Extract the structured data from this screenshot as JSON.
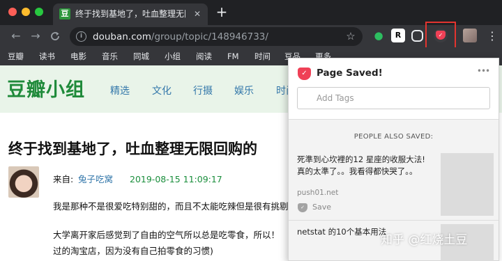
{
  "colors": {
    "tab_bar": "#202124",
    "toolbar": "#35363a",
    "douban_green": "#1f8a3a",
    "link_blue": "#3377aa",
    "pocket_red": "#ef4056",
    "highlight_red": "#e3342f"
  },
  "tab": {
    "favicon": "豆",
    "title": "终于找到基地了，吐血整理无限回购的",
    "close": "✕"
  },
  "newtab": "+",
  "toolbar": {
    "back": "←",
    "forward": "→",
    "reload": "C",
    "url_host": "douban.com",
    "url_path": "/group/topic/148946733/",
    "star": "☆",
    "extensions": {
      "evernote_icon": "evernote-icon",
      "r_label": "R",
      "pocket_icon": "pocket-icon"
    },
    "menu": "⋮"
  },
  "bookmarks": [
    "豆瓣",
    "读书",
    "电影",
    "音乐",
    "同城",
    "小组",
    "阅读",
    "FM",
    "时间",
    "豆品",
    "更多"
  ],
  "site": {
    "logo": "豆瓣小组",
    "nav": [
      "精选",
      "文化",
      "行摄",
      "娱乐",
      "时尚"
    ]
  },
  "topic": {
    "title": "终于找到基地了，吐血整理无限回购的",
    "from_label": "来自:",
    "author": "兔子吃窝",
    "time": "2019-08-15 11:09:17",
    "paragraphs": [
      "我是那种不是很爱吃特别甜的，而且不太能吃辣但是很有挑剔",
      "大学离开家后感觉到了自由的空气所以总是吃零食，所以！",
      "过的淘宝店，因为没有自己拍零食的习惯)"
    ]
  },
  "pocket": {
    "saved_title": "Page Saved!",
    "more": "•••",
    "tags_placeholder": "Add Tags",
    "also_saved_heading": "PEOPLE ALSO SAVED:",
    "recs": [
      {
        "text": "死準到心坎裡的12 星座的收服大法! 真的太準了。。我看得都快哭了。。",
        "domain": "push01.net",
        "save": "Save"
      },
      {
        "text": "netstat 的10个基本用法"
      }
    ]
  },
  "watermark": "知乎 @红烧土豆"
}
